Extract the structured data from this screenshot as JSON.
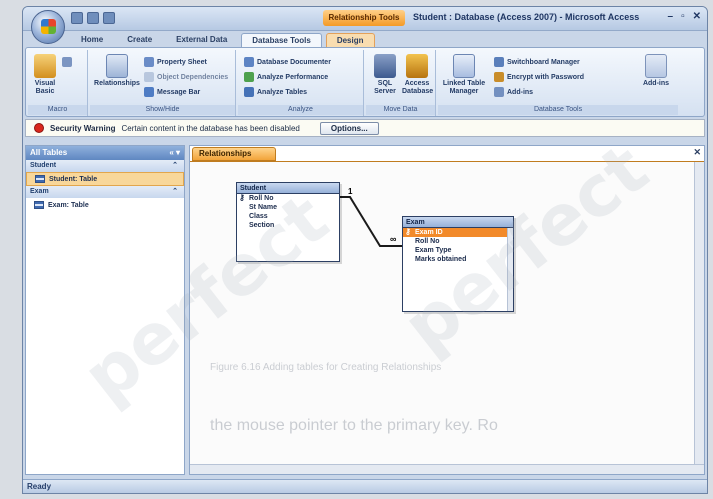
{
  "window": {
    "context_tab_label": "Relationship Tools",
    "title": "Student : Database (Access 2007) - Microsoft Access",
    "controls": [
      "–",
      "▫",
      "✕"
    ]
  },
  "ribbon": {
    "tabs": [
      {
        "label": "Home"
      },
      {
        "label": "Create"
      },
      {
        "label": "External Data"
      },
      {
        "label": "Database Tools",
        "active": true
      },
      {
        "label": "Design",
        "context": true
      }
    ],
    "groups": {
      "macro": {
        "label": "Macro",
        "big": "Visual Basic",
        "small": "Run Macro"
      },
      "show_hide": {
        "label": "Show/Hide",
        "big": "Relationships",
        "small": [
          "Property Sheet",
          "Object Dependencies",
          "Message Bar"
        ]
      },
      "analyze": {
        "label": "Analyze",
        "small": [
          "Database Documenter",
          "Analyze Performance",
          "Analyze Tables"
        ]
      },
      "move_data": {
        "label": "Move Data",
        "big": [
          "SQL Server",
          "Access Database"
        ]
      },
      "database_tools": {
        "label": "Database Tools",
        "big": [
          "Linked Table Manager",
          "Add-ins"
        ],
        "small": [
          "Switchboard Manager",
          "Encrypt with Password",
          "Add-ins"
        ]
      }
    }
  },
  "security_bar": {
    "label": "Security Warning",
    "message": "Certain content in the database has been disabled",
    "button": "Options..."
  },
  "nav_pane": {
    "header": "All Tables",
    "controls": "« ▾",
    "groups": [
      {
        "name": "Student",
        "items": [
          {
            "label": "Student: Table",
            "selected": true
          }
        ]
      },
      {
        "name": "Exam",
        "items": [
          {
            "label": "Exam: Table",
            "selected": false
          }
        ]
      }
    ]
  },
  "document": {
    "tab_label": "Relationships",
    "close": "✕"
  },
  "tables": {
    "student": {
      "title": "Student",
      "fields": [
        {
          "name": "Roll No",
          "key": true
        },
        {
          "name": "St Name",
          "key": false
        },
        {
          "name": "Class",
          "key": false
        },
        {
          "name": "Section",
          "key": false
        }
      ]
    },
    "exam": {
      "title": "Exam",
      "fields": [
        {
          "name": "Exam ID",
          "key": true,
          "selected": true
        },
        {
          "name": "Roll No",
          "key": false
        },
        {
          "name": "Exam Type",
          "key": false
        },
        {
          "name": "Marks obtained",
          "key": false
        }
      ]
    }
  },
  "relationship": {
    "from_label": "1",
    "to_label": "∞"
  },
  "status_bar": {
    "text": "Ready"
  },
  "background_text": {
    "caption": "Figure 6.16 Adding tables for Creating Relationships",
    "line1": "the mouse pointer to the primary key. Ro"
  },
  "watermark": "perfect"
}
